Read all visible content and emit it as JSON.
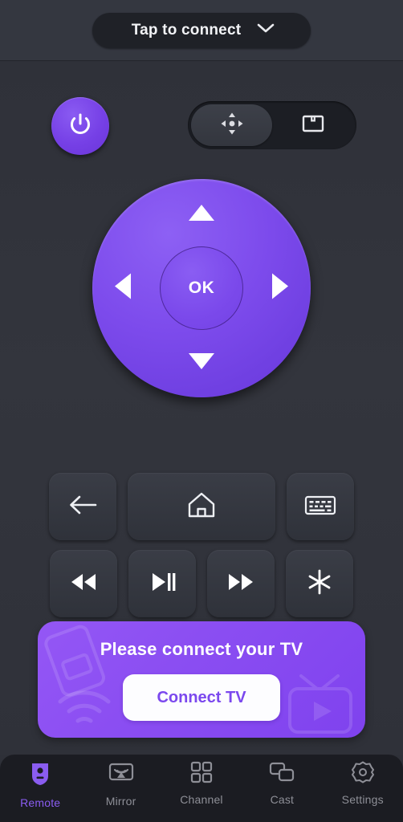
{
  "header": {
    "connect_label": "Tap to connect",
    "chevron_icon": "chevron-down-icon"
  },
  "controls": {
    "power_icon": "power-icon",
    "mode_toggle": {
      "options": [
        {
          "id": "dpad",
          "icon": "dpad-move-icon",
          "active": true
        },
        {
          "id": "touchpad",
          "icon": "touchpad-icon",
          "active": false
        }
      ]
    }
  },
  "dpad": {
    "ok_label": "OK",
    "up_icon": "arrow-up-icon",
    "down_icon": "arrow-down-icon",
    "left_icon": "arrow-left-icon",
    "right_icon": "arrow-right-icon"
  },
  "keys": {
    "row1": [
      {
        "id": "back",
        "icon": "back-arrow-icon",
        "wide": false
      },
      {
        "id": "home",
        "icon": "home-icon",
        "wide": true
      },
      {
        "id": "keyboard",
        "icon": "keyboard-icon",
        "wide": false
      }
    ],
    "row2": [
      {
        "id": "rewind",
        "icon": "rewind-icon"
      },
      {
        "id": "play-pause",
        "icon": "play-pause-icon"
      },
      {
        "id": "fast-forward",
        "icon": "fast-forward-icon"
      },
      {
        "id": "asterisk",
        "icon": "asterisk-icon"
      }
    ]
  },
  "banner": {
    "title": "Please connect your TV",
    "button_label": "Connect TV"
  },
  "bottom_nav": {
    "items": [
      {
        "label": "Remote",
        "icon": "remote-icon",
        "active": true
      },
      {
        "label": "Mirror",
        "icon": "mirror-icon",
        "active": false
      },
      {
        "label": "Channel",
        "icon": "channel-grid-icon",
        "active": false
      },
      {
        "label": "Cast",
        "icon": "cast-icon",
        "active": false
      },
      {
        "label": "Settings",
        "icon": "gear-icon",
        "active": false
      }
    ]
  },
  "colors": {
    "accent_purple": "#7B48EE",
    "banner_purple": "#8B4EF2",
    "background": "#2F3139",
    "header_bg": "#343740",
    "nav_bg": "#1B1C22",
    "key_bg": "#353842",
    "text_muted": "#8E8F97"
  }
}
